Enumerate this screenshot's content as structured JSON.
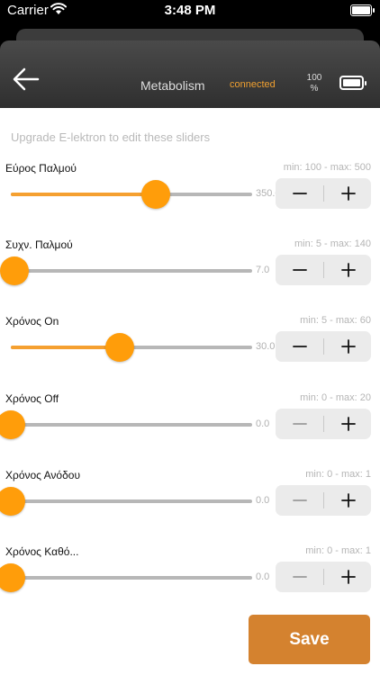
{
  "status_bar": {
    "carrier": "Carrier",
    "time": "3:48 PM"
  },
  "header": {
    "title": "Metabolism",
    "connection": "connected",
    "battery_percent": "100",
    "battery_unit": "%",
    "colors": {
      "connection": "#f0a030"
    }
  },
  "upgrade_notice": "Upgrade E-lektron to edit these sliders",
  "sliders": [
    {
      "label": "Εύρος Παλμού",
      "range": "min: 100 - max: 500",
      "value": "350.0",
      "level": 0.6,
      "minus_enabled": true
    },
    {
      "label": "Συχν. Παλμού",
      "range": "min: 5 - max: 140",
      "value": "7.0",
      "level": 0.015,
      "minus_enabled": true
    },
    {
      "label": "Χρόνος On",
      "range": "min: 5 - max: 60",
      "value": "30.0",
      "level": 0.45,
      "minus_enabled": true
    },
    {
      "label": "Χρόνος Off",
      "range": "min: 0 - max: 20",
      "value": "0.0",
      "level": 0.0,
      "minus_enabled": false
    },
    {
      "label": "Χρόνος Ανόδου",
      "range": "min: 0 - max: 1",
      "value": "0.0",
      "level": 0.0,
      "minus_enabled": false
    },
    {
      "label": "Χρόνος Καθό...",
      "range": "min: 0 - max: 1",
      "value": "0.0",
      "level": 0.0,
      "minus_enabled": false
    }
  ],
  "save_label": "Save",
  "colors": {
    "accent": "#ff9d0a",
    "save": "#d4822f",
    "track": "#b7b7b7"
  },
  "icons": {
    "back": "arrow-left-icon",
    "minus": "minus-icon",
    "plus": "plus-icon"
  }
}
